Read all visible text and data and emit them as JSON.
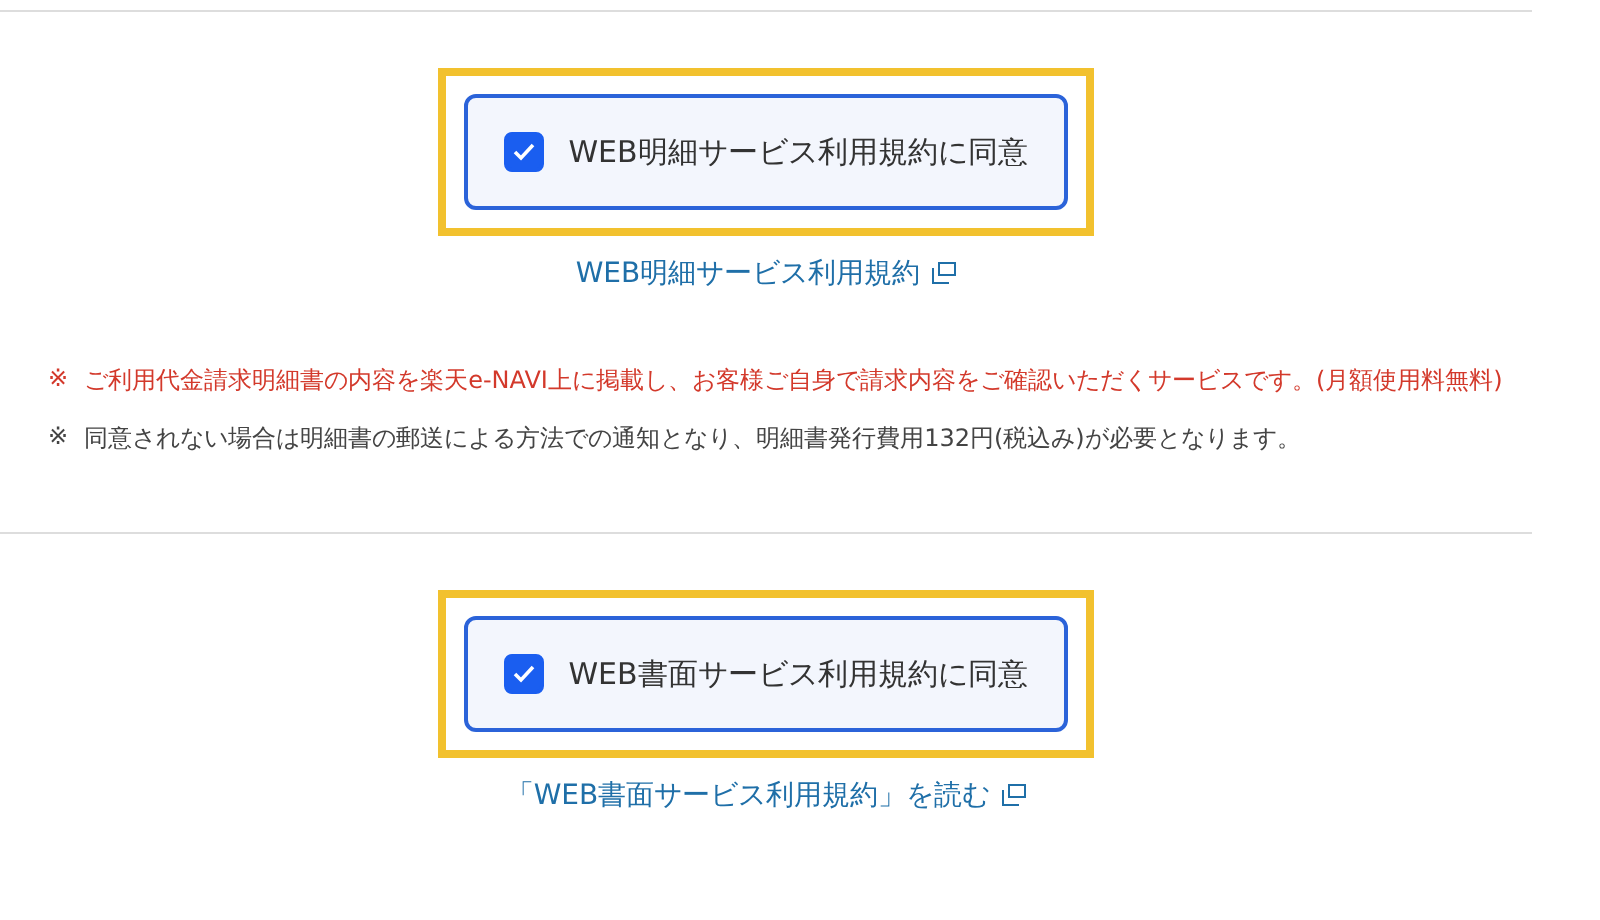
{
  "sections": [
    {
      "agree": {
        "label": "WEB明細サービス利用規約に同意",
        "checked": true,
        "highlighted": true
      },
      "link": {
        "text": "WEB明細サービス利用規約"
      },
      "notes": [
        {
          "mark": "※",
          "text": "ご利用代金請求明細書の内容を楽天e-NAVI上に掲載し、お客様ご自身で請求内容をご確認いただくサービスです。(月額使用料無料)",
          "kind": "warning"
        },
        {
          "mark": "※",
          "text": "同意されない場合は明細書の郵送による方法での通知となり、明細書発行費用132円(税込み)が必要となります。",
          "kind": "info"
        }
      ]
    },
    {
      "agree": {
        "label": "WEB書面サービス利用規約に同意",
        "checked": true,
        "highlighted": true
      },
      "link": {
        "text": "「WEB書面サービス利用規約」を読む"
      }
    }
  ]
}
